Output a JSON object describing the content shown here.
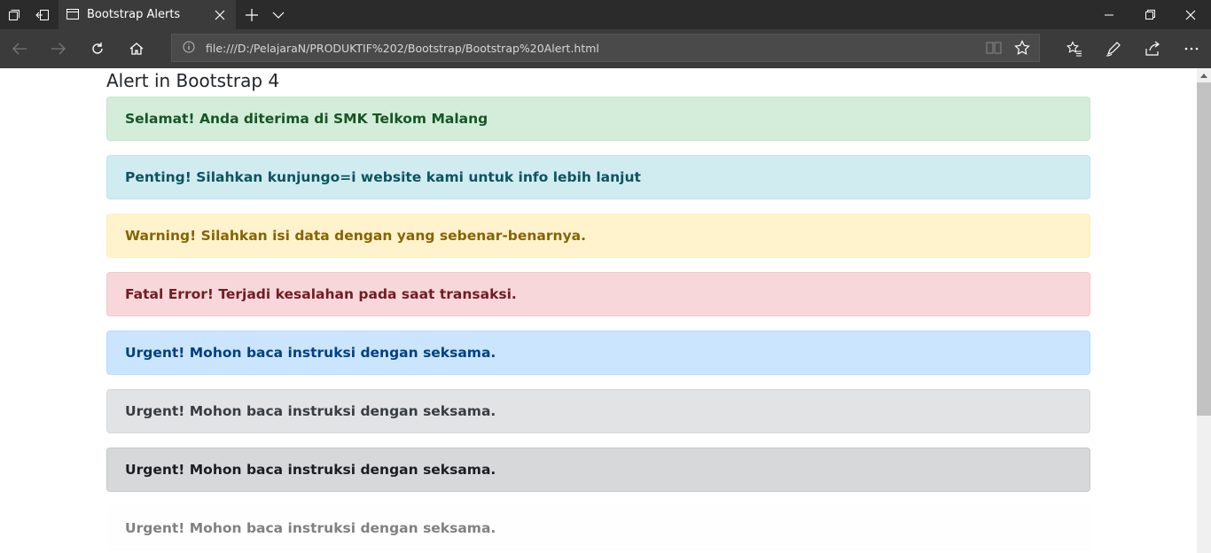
{
  "browser": {
    "tab_title": "Bootstrap Alerts",
    "url": "file:///D:/PelajaraN/PRODUKTIF%202/Bootstrap/Bootstrap%20Alert.html",
    "icons": [
      "tab-set-aside-icon",
      "tab-preview-icon",
      "page-icon",
      "close-tab-icon",
      "new-tab-icon",
      "tab-list-icon",
      "minimize-icon",
      "restore-icon",
      "close-window-icon",
      "back-icon",
      "forward-icon",
      "refresh-icon",
      "home-icon",
      "info-icon",
      "reading-view-icon",
      "favorite-star-icon",
      "favorites-hub-icon",
      "pen-icon",
      "share-icon",
      "more-icon"
    ]
  },
  "page": {
    "heading": "Alert in Bootstrap 4",
    "alerts": [
      {
        "strong": "Selamat!",
        "text": " Anda diterima di SMK Telkom Malang"
      },
      {
        "strong": "Penting!",
        "text": " Silahkan kunjungo=i website kami untuk info lebih lanjut"
      },
      {
        "strong": "Warning!",
        "text": " Silahkan isi data dengan yang sebenar-benarnya."
      },
      {
        "strong": "Fatal Error!",
        "text": " Terjadi kesalahan pada saat transaksi."
      },
      {
        "strong": "Urgent!",
        "text": " Mohon baca instruksi dengan seksama."
      },
      {
        "strong": "Urgent!",
        "text": " Mohon baca instruksi dengan seksama."
      },
      {
        "strong": "Urgent!",
        "text": " Mohon baca instruksi dengan seksama."
      },
      {
        "strong": "Urgent!",
        "text": " Mohon baca instruksi dengan seksama."
      }
    ]
  }
}
